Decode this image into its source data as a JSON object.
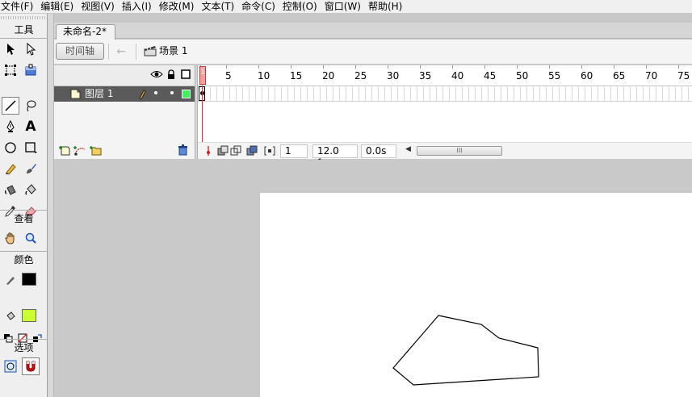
{
  "menubar": {
    "items": [
      "文件(F)",
      "编辑(E)",
      "视图(V)",
      "插入(I)",
      "修改(M)",
      "文本(T)",
      "命令(C)",
      "控制(O)",
      "窗口(W)",
      "帮助(H)"
    ]
  },
  "toolbox": {
    "tools_title": "工具",
    "view_title": "查看",
    "color_title": "颜色",
    "options_title": "选项",
    "text_tool_glyph": "A",
    "stroke_color": "#000000",
    "fill_color": "#ccff33",
    "selected_tool": "line-tool"
  },
  "document": {
    "tab_title": "未命名-2*"
  },
  "toolbar": {
    "timeline_button": "时间轴",
    "scene_label": "场景 1"
  },
  "timeline": {
    "layer_name": "图层 1",
    "ruler_marks": [
      "1",
      "5",
      "10",
      "15",
      "20",
      "25",
      "30",
      "35",
      "40",
      "45",
      "50",
      "55",
      "60",
      "65",
      "70",
      "75"
    ],
    "current_frame": "1",
    "frame_rate": "12.0 fps",
    "elapsed_time": "0.0s",
    "scroll_grip": "III"
  },
  "stage": {
    "shape_color": "#000000"
  }
}
